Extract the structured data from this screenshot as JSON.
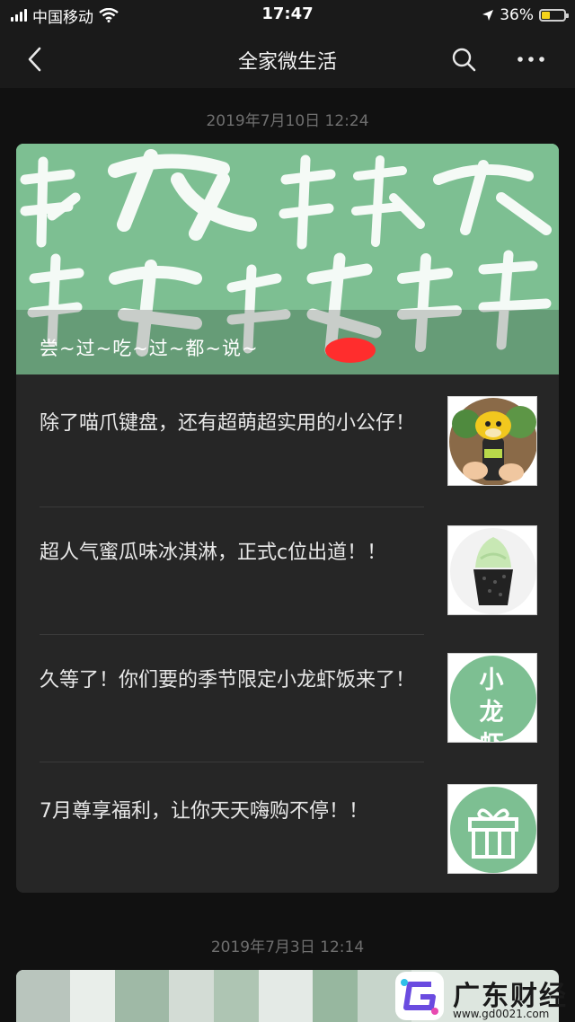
{
  "status": {
    "carrier": "中国移动",
    "time": "17:47",
    "battery_pct": "36%",
    "battery_level": 0.36
  },
  "nav": {
    "title": "全家微生活"
  },
  "feed": [
    {
      "date": "2019年7月10日 12:24",
      "hero": {
        "caption": "尝~过~吃~过~都~说~"
      },
      "items": [
        {
          "text": "除了喵爪键盘，还有超萌超实用的小公仔！"
        },
        {
          "text": "超人气蜜瓜味冰淇淋，正式c位出道！！"
        },
        {
          "text": "久等了！你们要的季节限定小龙虾饭来了！",
          "thumb_text": "小龙虾"
        },
        {
          "text": "7月尊享福利，让你天天嗨购不停！！"
        }
      ]
    },
    {
      "date": "2019年7月3日 12:14"
    }
  ],
  "watermark": {
    "name": "广东财经",
    "url": "www.gd0021.com"
  },
  "colors": {
    "accent_green": "#7dbf92",
    "battery": "#f5d31a",
    "bg": "#111111",
    "card": "#262626"
  }
}
